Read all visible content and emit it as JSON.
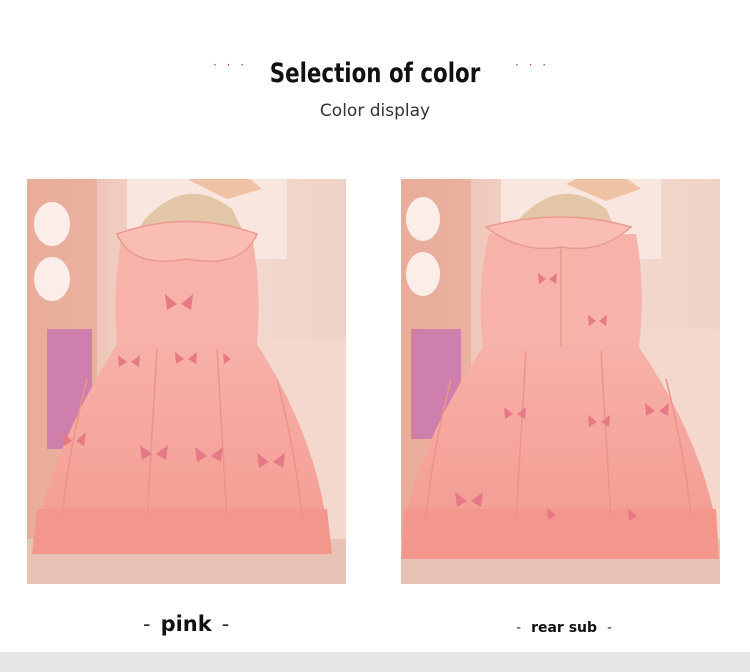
{
  "header": {
    "title": "Selection of color",
    "subtitle": "Color display",
    "ornament": "· · ·"
  },
  "colors": {
    "accent": "#c0392b",
    "dress": "#f6a9a2",
    "dress_shade": "#ee9289",
    "butterfly": "#e57a86",
    "background": "#ffffff",
    "footer": "#e7e7e7"
  },
  "products": [
    {
      "view": "front",
      "label": "pink",
      "dash": "-"
    },
    {
      "view": "back",
      "label": "rear sub",
      "dash": "-"
    }
  ]
}
